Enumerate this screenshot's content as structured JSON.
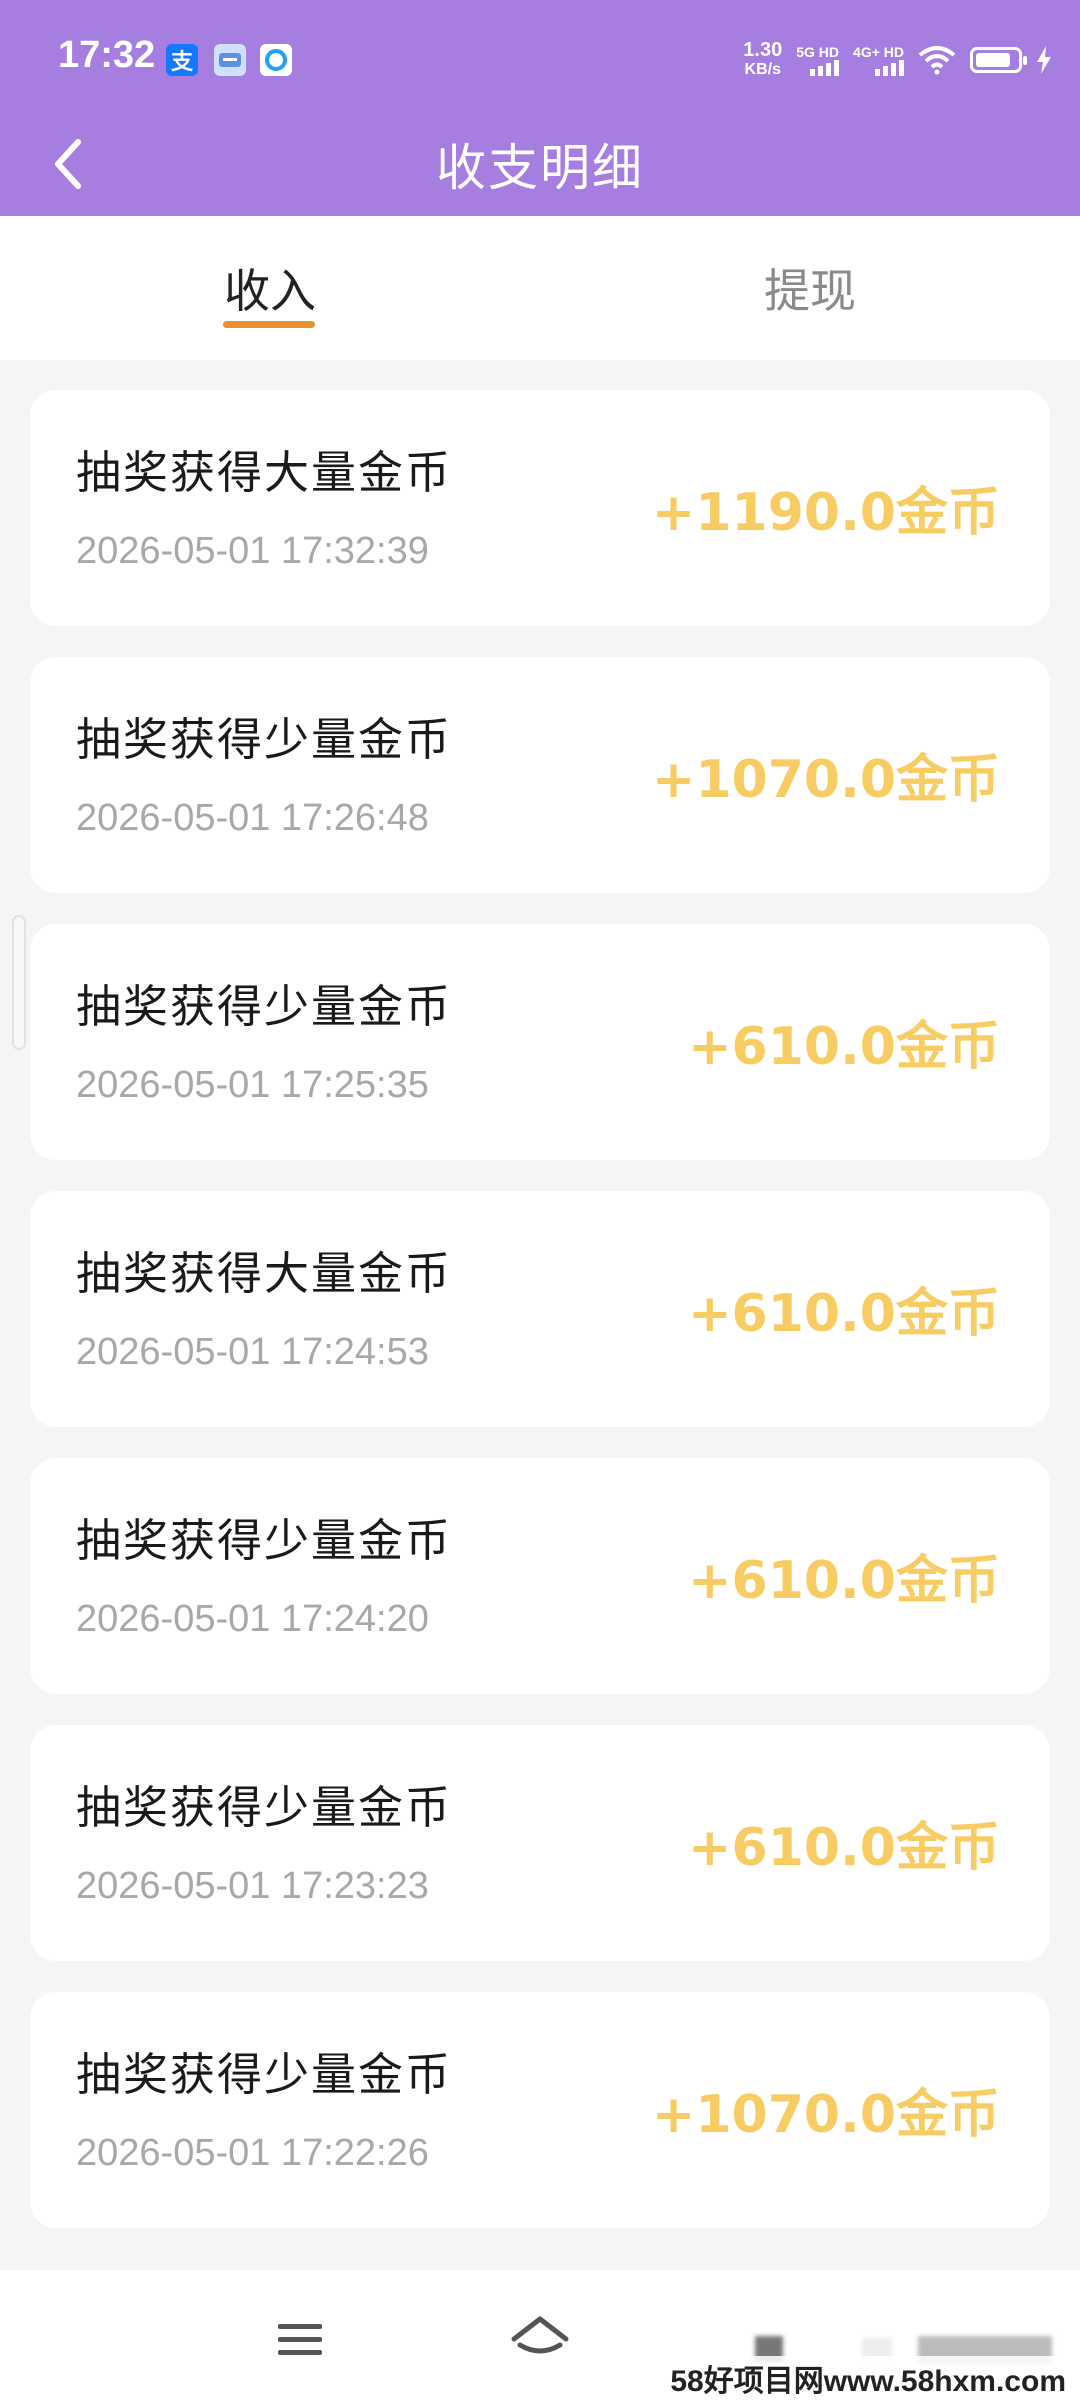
{
  "status_bar": {
    "time": "17:32",
    "app_icons": [
      "alipay-icon",
      "app-icon",
      "browser-icon"
    ],
    "net_speed_value": "1.30",
    "net_speed_unit": "KB/s",
    "sim1_label": "5G HD",
    "sim2_label": "4G+ HD",
    "icons": [
      "wifi-icon",
      "battery-icon",
      "charging-icon"
    ]
  },
  "header": {
    "title": "收支明细",
    "back_icon": "chevron-left-icon",
    "bg_color": "#a57ee0"
  },
  "tabs": [
    {
      "label": "收入",
      "active": true
    },
    {
      "label": "提现",
      "active": false
    }
  ],
  "accent_color": "#e8902c",
  "amount_color": "#f7cd63",
  "records": [
    {
      "title": "抽奖获得大量金币",
      "time": "2026-05-01 17:32:39",
      "amount": "+1190.0金币"
    },
    {
      "title": "抽奖获得少量金币",
      "time": "2026-05-01 17:26:48",
      "amount": "+1070.0金币"
    },
    {
      "title": "抽奖获得少量金币",
      "time": "2026-05-01 17:25:35",
      "amount": "+610.0金币"
    },
    {
      "title": "抽奖获得大量金币",
      "time": "2026-05-01 17:24:53",
      "amount": "+610.0金币"
    },
    {
      "title": "抽奖获得少量金币",
      "time": "2026-05-01 17:24:20",
      "amount": "+610.0金币"
    },
    {
      "title": "抽奖获得少量金币",
      "time": "2026-05-01 17:23:23",
      "amount": "+610.0金币"
    },
    {
      "title": "抽奖获得少量金币",
      "time": "2026-05-01 17:22:26",
      "amount": "+1070.0金币"
    }
  ],
  "bottom_nav": {
    "icons": [
      "menu-icon",
      "home-icon"
    ]
  },
  "watermark": "58好项目网www.58hxm.com"
}
